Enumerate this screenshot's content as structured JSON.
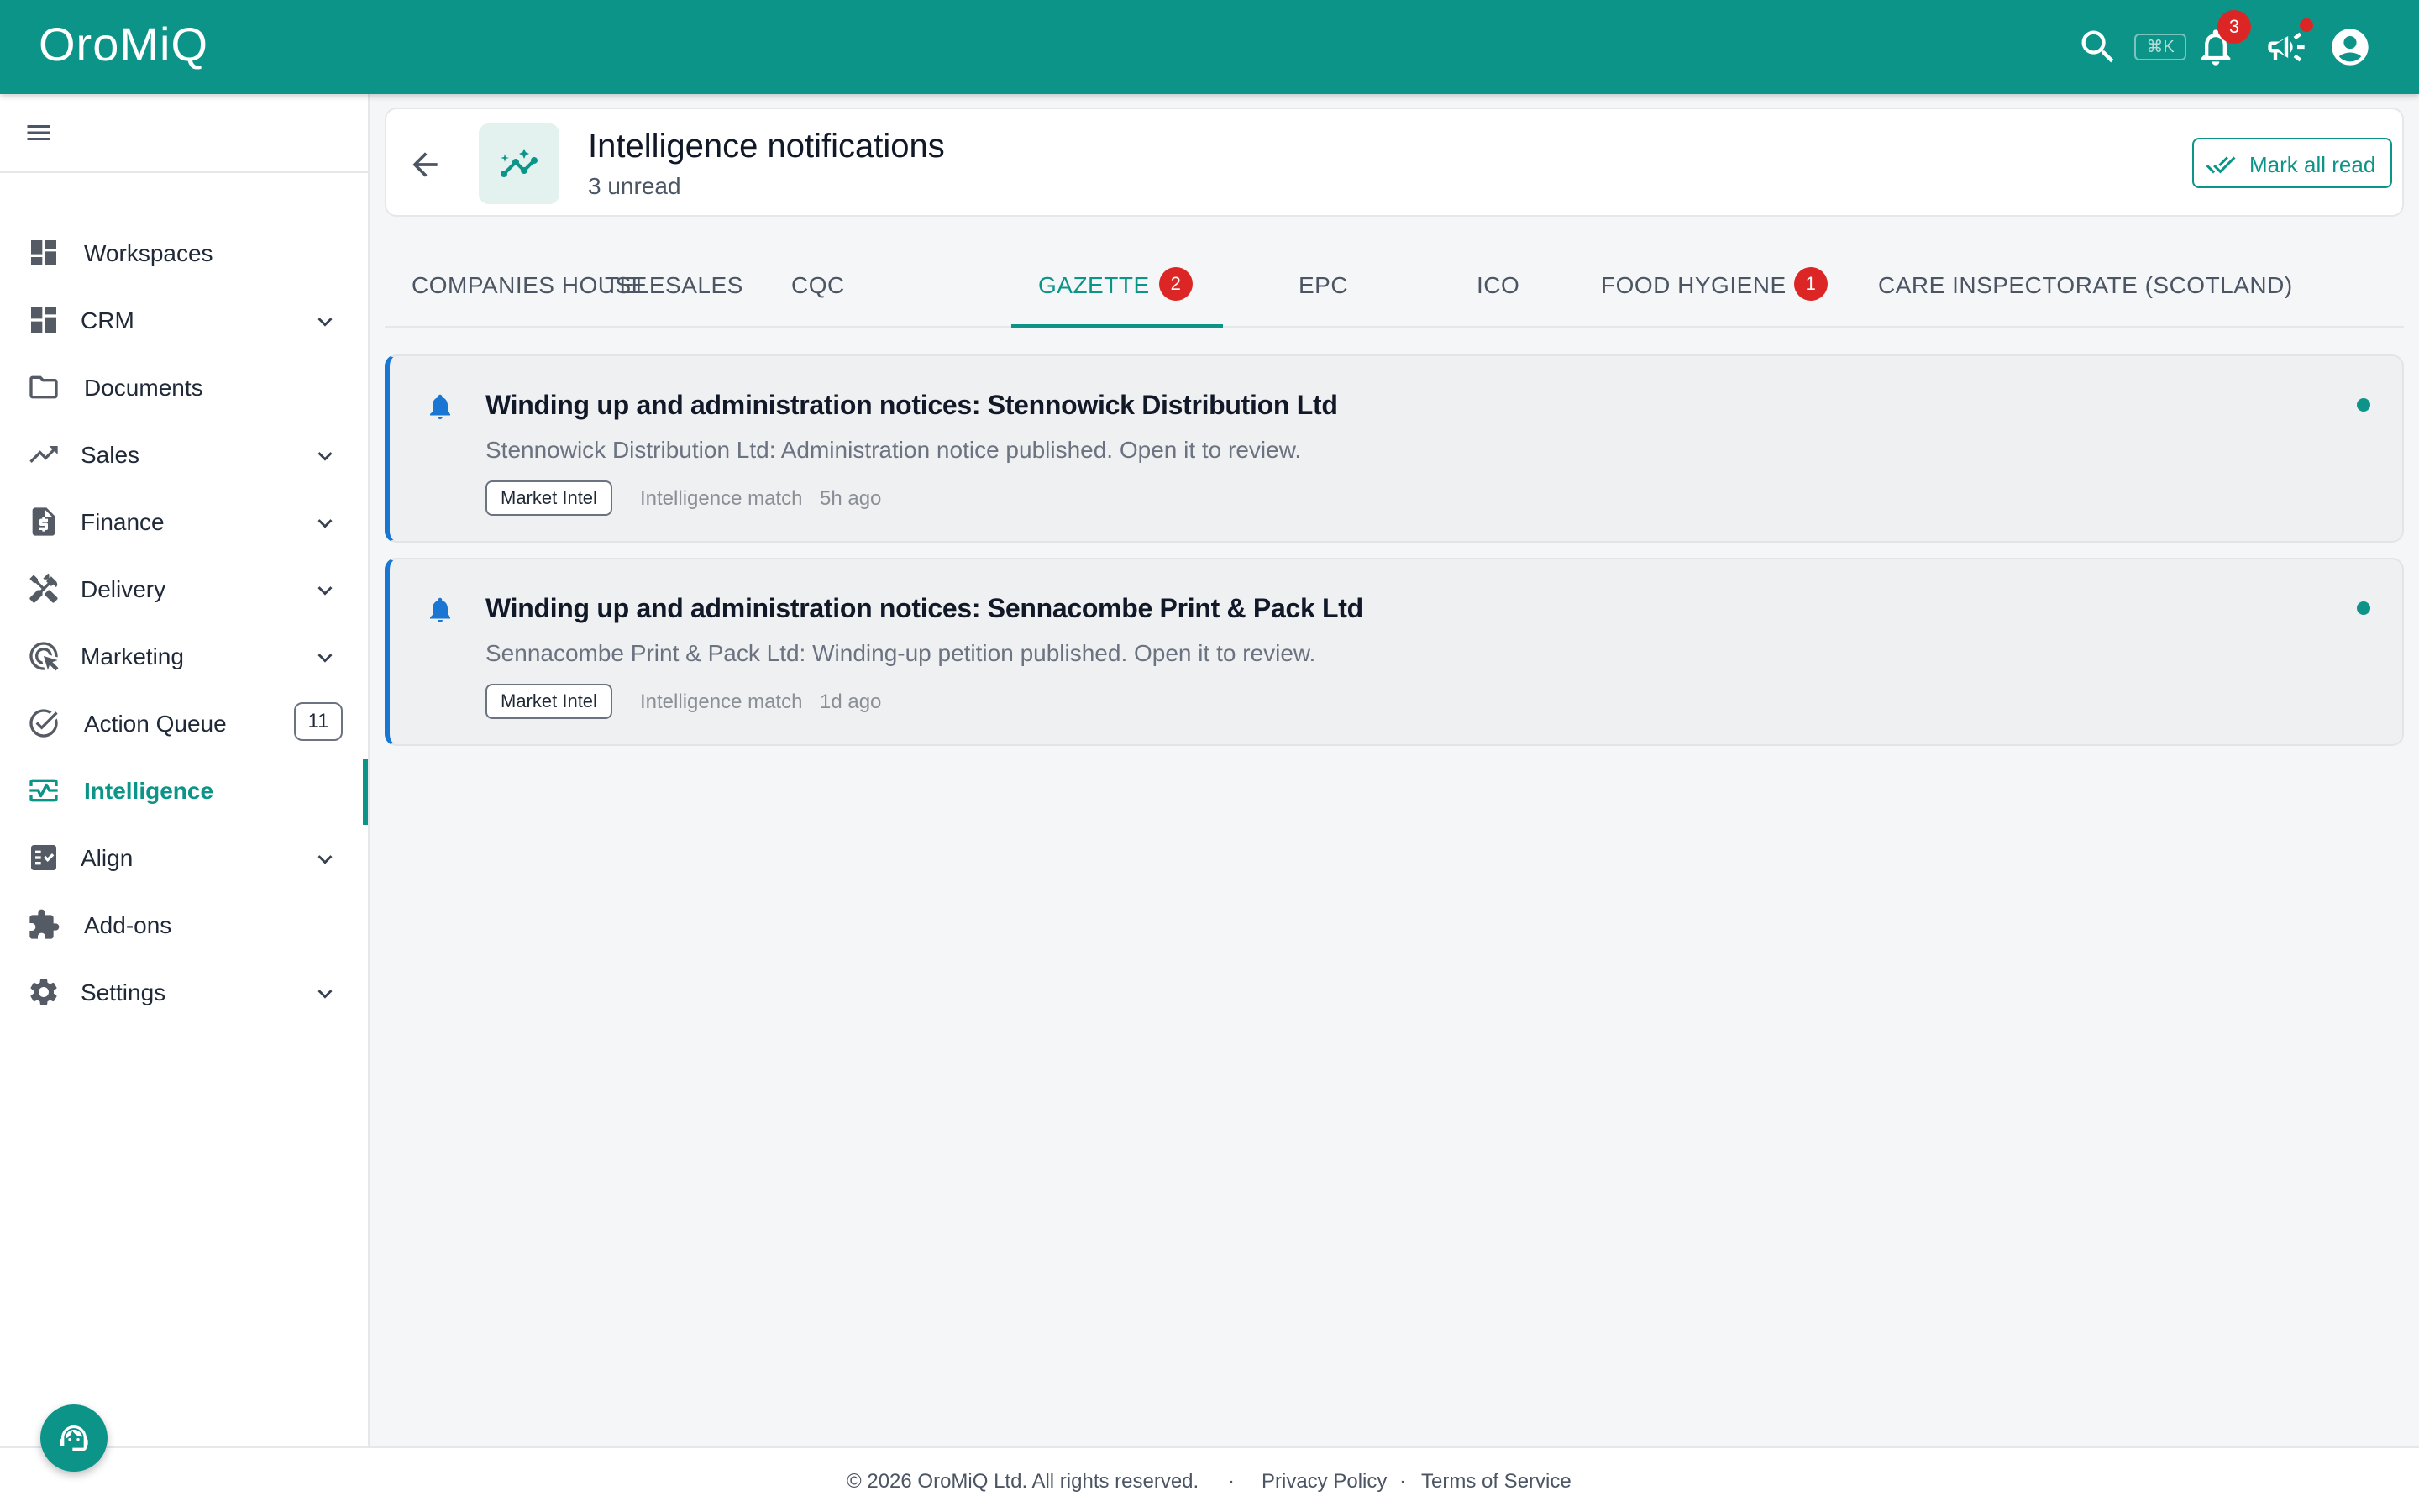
{
  "app": {
    "logo": "OroMiQ",
    "kbd_hint": "⌘K",
    "notification_count": "3"
  },
  "sidebar": {
    "items": [
      {
        "label": "Workspaces",
        "icon": "dashboard-icon",
        "expandable": false
      },
      {
        "label": "CRM",
        "icon": "grid-icon",
        "expandable": true
      },
      {
        "label": "Documents",
        "icon": "folder-icon",
        "expandable": false
      },
      {
        "label": "Sales",
        "icon": "trending-up-icon",
        "expandable": true
      },
      {
        "label": "Finance",
        "icon": "invoice-icon",
        "expandable": true
      },
      {
        "label": "Delivery",
        "icon": "tools-icon",
        "expandable": true
      },
      {
        "label": "Marketing",
        "icon": "target-icon",
        "expandable": true
      },
      {
        "label": "Action Queue",
        "icon": "check-circle-icon",
        "expandable": false,
        "count": "11"
      },
      {
        "label": "Intelligence",
        "icon": "monitor-heart-icon",
        "expandable": false,
        "active": true
      },
      {
        "label": "Align",
        "icon": "checklist-icon",
        "expandable": true
      },
      {
        "label": "Add-ons",
        "icon": "puzzle-icon",
        "expandable": false
      },
      {
        "label": "Settings",
        "icon": "gear-icon",
        "expandable": true
      }
    ]
  },
  "header": {
    "title": "Intelligence notifications",
    "subtitle": "3 unread",
    "mark_all_read": "Mark all read"
  },
  "tabs": [
    {
      "label": "COMPANIES HOUSE"
    },
    {
      "label": "TELESALES"
    },
    {
      "label": "CQC"
    },
    {
      "label": "GAZETTE",
      "badge": "2",
      "active": true
    },
    {
      "label": "EPC"
    },
    {
      "label": "ICO"
    },
    {
      "label": "FOOD HYGIENE",
      "badge": "1"
    },
    {
      "label": "CARE INSPECTORATE (SCOTLAND)"
    }
  ],
  "notifications": [
    {
      "title": "Winding up and administration notices: Stennowick Distribution Ltd",
      "description": "Stennowick Distribution Ltd: Administration notice published. Open it to review.",
      "tag": "Market Intel",
      "meta": "Intelligence match",
      "time": "5h ago",
      "unread": true
    },
    {
      "title": "Winding up and administration notices: Sennacombe Print & Pack Ltd",
      "description": "Sennacombe Print & Pack Ltd: Winding-up petition published. Open it to review.",
      "tag": "Market Intel",
      "meta": "Intelligence match",
      "time": "1d ago",
      "unread": true
    }
  ],
  "footer": {
    "copyright": "© 2026 OroMiQ Ltd. All rights reserved.",
    "separator": "·",
    "privacy": "Privacy Policy",
    "terms": "Terms of Service"
  },
  "colors": {
    "primary": "#0d9488",
    "badge": "#dc2626",
    "bell": "#1976d2"
  }
}
